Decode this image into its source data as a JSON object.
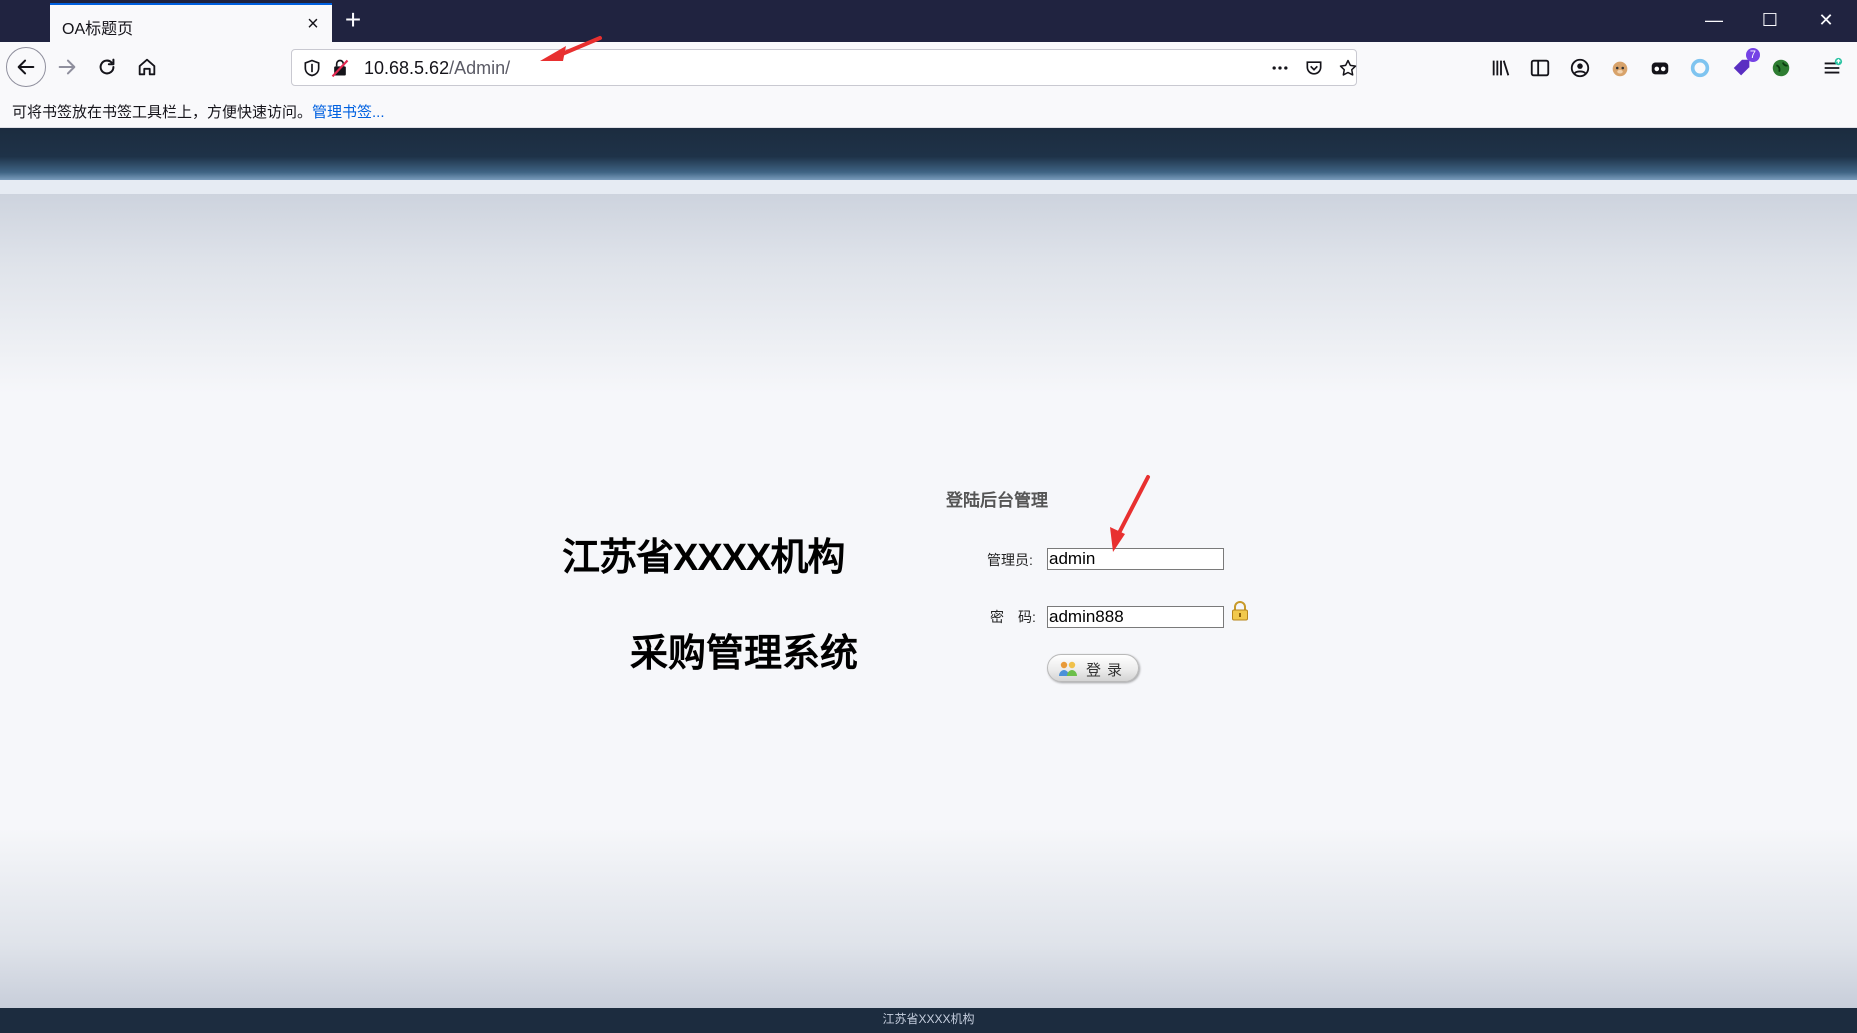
{
  "browser": {
    "tab": {
      "title": "OA标题页"
    },
    "url": {
      "host": "10.68.5.62",
      "path": "/Admin/"
    },
    "toolbar_badge_count": "7",
    "bookmarks_bar": {
      "hint": "可将书签放在书签工具栏上，方便快速访问。",
      "manage_link": "管理书签..."
    }
  },
  "page": {
    "system_title_line1": "江苏省XXXX机构",
    "system_title_line2": "采购管理系统",
    "login": {
      "heading": "登陆后台管理",
      "admin_label": "管理员:",
      "admin_value": "admin",
      "password_label": "密　码:",
      "password_value": "admin888",
      "submit_label": "登录"
    },
    "footer": "江苏省XXXX机构"
  },
  "colors": {
    "accent": "#0060df",
    "header_dark": "#1c2c3f",
    "annotation_arrow": "#e83030"
  }
}
